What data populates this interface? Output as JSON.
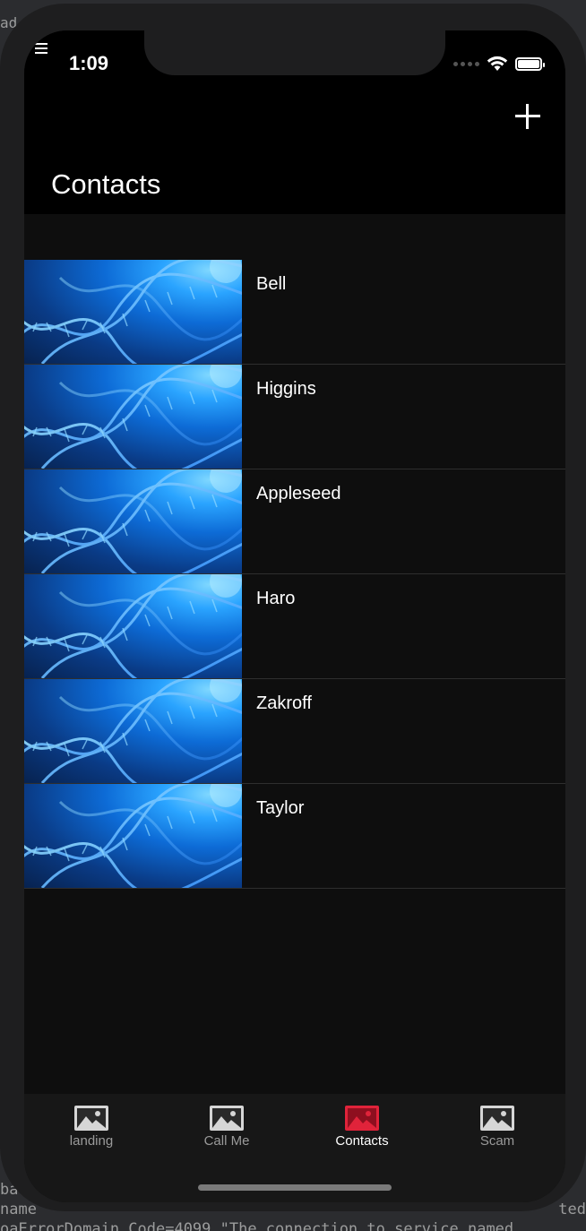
{
  "console": {
    "top_fragment": "ad",
    "left_fragment_1": "ba",
    "left_fragment_2": "name",
    "right_fragment": "ted",
    "bottom_line": "oaErrorDomain Code=4099 \"The connection to service named"
  },
  "status_bar": {
    "time": "1:09"
  },
  "header": {
    "title": "Contacts"
  },
  "contacts": [
    {
      "name": "Bell"
    },
    {
      "name": "Higgins"
    },
    {
      "name": "Appleseed"
    },
    {
      "name": "Haro"
    },
    {
      "name": "Zakroff"
    },
    {
      "name": "Taylor"
    }
  ],
  "tabs": [
    {
      "label": "landing",
      "icon": "image-icon",
      "active": false
    },
    {
      "label": "Call Me",
      "icon": "image-icon",
      "active": false
    },
    {
      "label": "Contacts",
      "icon": "image-icon",
      "active": true
    },
    {
      "label": "Scam",
      "icon": "image-icon",
      "active": false
    }
  ],
  "colors": {
    "accent": "#e0233a",
    "tab_inactive": "#9a9a9a",
    "background": "#0e0e0e"
  }
}
